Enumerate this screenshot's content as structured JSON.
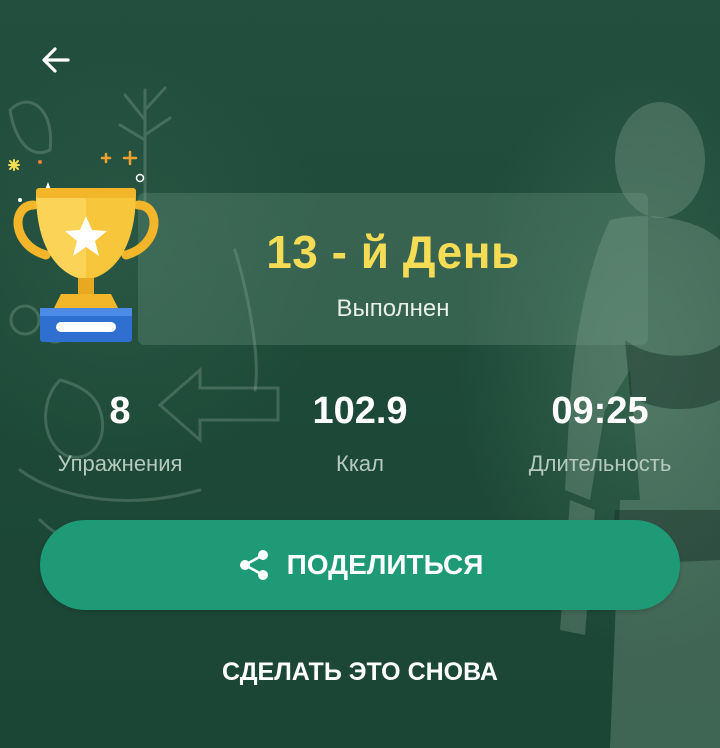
{
  "header": {
    "back_icon": "arrow-left-icon"
  },
  "result": {
    "day_title": "13 - й День",
    "status": "Выполнен",
    "trophy_icon": "trophy-icon"
  },
  "stats": [
    {
      "value": "8",
      "label": "Упражнения"
    },
    {
      "value": "102.9",
      "label": "Ккал"
    },
    {
      "value": "09:25",
      "label": "Длительность"
    }
  ],
  "actions": {
    "share_label": "ПОДЕЛИТЬСЯ",
    "share_icon": "share-icon",
    "repeat_label": "СДЕЛАТЬ ЭТО СНОВА"
  },
  "colors": {
    "background": "#1f4a3a",
    "accent": "#1f9a76",
    "title": "#f5dc55"
  }
}
